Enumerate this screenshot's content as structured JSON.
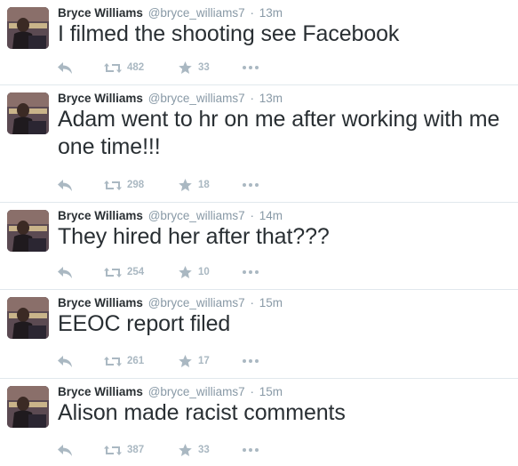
{
  "account": {
    "fullname": "Bryce Williams",
    "username": "@bryce_williams7"
  },
  "separator": "·",
  "tweets": [
    {
      "time": "13m",
      "text": "I filmed the shooting see Facebook",
      "retweets": "482",
      "favorites": "33"
    },
    {
      "time": "13m",
      "text": "Adam went to hr on me after working with me one time!!!",
      "retweets": "298",
      "favorites": "18"
    },
    {
      "time": "14m",
      "text": "They hired her after that???",
      "retweets": "254",
      "favorites": "10"
    },
    {
      "time": "15m",
      "text": "EEOC report filed",
      "retweets": "261",
      "favorites": "17"
    },
    {
      "time": "15m",
      "text": "Alison made racist comments",
      "retweets": "387",
      "favorites": "33"
    }
  ],
  "icons": {
    "reply": "reply-icon",
    "retweet": "retweet-icon",
    "favorite": "star-icon",
    "more": "more-dots-icon"
  },
  "colors": {
    "text": "#292f33",
    "meta": "#8899a6",
    "action_icons": "#aab8c2",
    "divider": "#e1e8ed"
  }
}
